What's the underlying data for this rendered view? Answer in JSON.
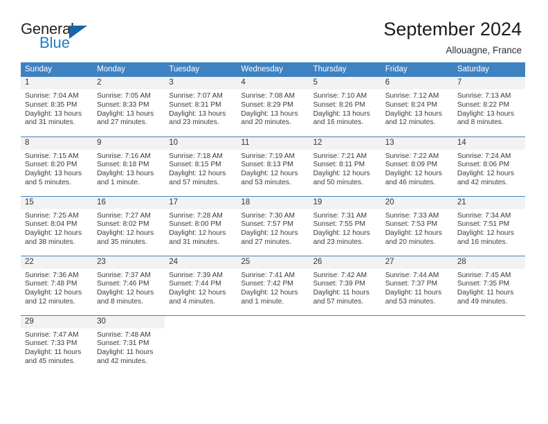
{
  "brand": {
    "name_part1": "General",
    "name_part2": "Blue",
    "triangle_icon": "triangle-icon",
    "colors": {
      "dark": "#231f20",
      "blue": "#1f7dc4",
      "triangle": "#1565a8"
    }
  },
  "header": {
    "title": "September 2024",
    "subtitle": "Allouagne, France"
  },
  "calendar": {
    "accent_color": "#3f82c2",
    "daynum_background": "#f2f2f2",
    "weekdays": [
      "Sunday",
      "Monday",
      "Tuesday",
      "Wednesday",
      "Thursday",
      "Friday",
      "Saturday"
    ],
    "weeks": [
      [
        {
          "day": "1",
          "sunrise": "Sunrise: 7:04 AM",
          "sunset": "Sunset: 8:35 PM",
          "daylight_line1": "Daylight: 13 hours",
          "daylight_line2": "and 31 minutes."
        },
        {
          "day": "2",
          "sunrise": "Sunrise: 7:05 AM",
          "sunset": "Sunset: 8:33 PM",
          "daylight_line1": "Daylight: 13 hours",
          "daylight_line2": "and 27 minutes."
        },
        {
          "day": "3",
          "sunrise": "Sunrise: 7:07 AM",
          "sunset": "Sunset: 8:31 PM",
          "daylight_line1": "Daylight: 13 hours",
          "daylight_line2": "and 23 minutes."
        },
        {
          "day": "4",
          "sunrise": "Sunrise: 7:08 AM",
          "sunset": "Sunset: 8:29 PM",
          "daylight_line1": "Daylight: 13 hours",
          "daylight_line2": "and 20 minutes."
        },
        {
          "day": "5",
          "sunrise": "Sunrise: 7:10 AM",
          "sunset": "Sunset: 8:26 PM",
          "daylight_line1": "Daylight: 13 hours",
          "daylight_line2": "and 16 minutes."
        },
        {
          "day": "6",
          "sunrise": "Sunrise: 7:12 AM",
          "sunset": "Sunset: 8:24 PM",
          "daylight_line1": "Daylight: 13 hours",
          "daylight_line2": "and 12 minutes."
        },
        {
          "day": "7",
          "sunrise": "Sunrise: 7:13 AM",
          "sunset": "Sunset: 8:22 PM",
          "daylight_line1": "Daylight: 13 hours",
          "daylight_line2": "and 8 minutes."
        }
      ],
      [
        {
          "day": "8",
          "sunrise": "Sunrise: 7:15 AM",
          "sunset": "Sunset: 8:20 PM",
          "daylight_line1": "Daylight: 13 hours",
          "daylight_line2": "and 5 minutes."
        },
        {
          "day": "9",
          "sunrise": "Sunrise: 7:16 AM",
          "sunset": "Sunset: 8:18 PM",
          "daylight_line1": "Daylight: 13 hours",
          "daylight_line2": "and 1 minute."
        },
        {
          "day": "10",
          "sunrise": "Sunrise: 7:18 AM",
          "sunset": "Sunset: 8:15 PM",
          "daylight_line1": "Daylight: 12 hours",
          "daylight_line2": "and 57 minutes."
        },
        {
          "day": "11",
          "sunrise": "Sunrise: 7:19 AM",
          "sunset": "Sunset: 8:13 PM",
          "daylight_line1": "Daylight: 12 hours",
          "daylight_line2": "and 53 minutes."
        },
        {
          "day": "12",
          "sunrise": "Sunrise: 7:21 AM",
          "sunset": "Sunset: 8:11 PM",
          "daylight_line1": "Daylight: 12 hours",
          "daylight_line2": "and 50 minutes."
        },
        {
          "day": "13",
          "sunrise": "Sunrise: 7:22 AM",
          "sunset": "Sunset: 8:09 PM",
          "daylight_line1": "Daylight: 12 hours",
          "daylight_line2": "and 46 minutes."
        },
        {
          "day": "14",
          "sunrise": "Sunrise: 7:24 AM",
          "sunset": "Sunset: 8:06 PM",
          "daylight_line1": "Daylight: 12 hours",
          "daylight_line2": "and 42 minutes."
        }
      ],
      [
        {
          "day": "15",
          "sunrise": "Sunrise: 7:25 AM",
          "sunset": "Sunset: 8:04 PM",
          "daylight_line1": "Daylight: 12 hours",
          "daylight_line2": "and 38 minutes."
        },
        {
          "day": "16",
          "sunrise": "Sunrise: 7:27 AM",
          "sunset": "Sunset: 8:02 PM",
          "daylight_line1": "Daylight: 12 hours",
          "daylight_line2": "and 35 minutes."
        },
        {
          "day": "17",
          "sunrise": "Sunrise: 7:28 AM",
          "sunset": "Sunset: 8:00 PM",
          "daylight_line1": "Daylight: 12 hours",
          "daylight_line2": "and 31 minutes."
        },
        {
          "day": "18",
          "sunrise": "Sunrise: 7:30 AM",
          "sunset": "Sunset: 7:57 PM",
          "daylight_line1": "Daylight: 12 hours",
          "daylight_line2": "and 27 minutes."
        },
        {
          "day": "19",
          "sunrise": "Sunrise: 7:31 AM",
          "sunset": "Sunset: 7:55 PM",
          "daylight_line1": "Daylight: 12 hours",
          "daylight_line2": "and 23 minutes."
        },
        {
          "day": "20",
          "sunrise": "Sunrise: 7:33 AM",
          "sunset": "Sunset: 7:53 PM",
          "daylight_line1": "Daylight: 12 hours",
          "daylight_line2": "and 20 minutes."
        },
        {
          "day": "21",
          "sunrise": "Sunrise: 7:34 AM",
          "sunset": "Sunset: 7:51 PM",
          "daylight_line1": "Daylight: 12 hours",
          "daylight_line2": "and 16 minutes."
        }
      ],
      [
        {
          "day": "22",
          "sunrise": "Sunrise: 7:36 AM",
          "sunset": "Sunset: 7:48 PM",
          "daylight_line1": "Daylight: 12 hours",
          "daylight_line2": "and 12 minutes."
        },
        {
          "day": "23",
          "sunrise": "Sunrise: 7:37 AM",
          "sunset": "Sunset: 7:46 PM",
          "daylight_line1": "Daylight: 12 hours",
          "daylight_line2": "and 8 minutes."
        },
        {
          "day": "24",
          "sunrise": "Sunrise: 7:39 AM",
          "sunset": "Sunset: 7:44 PM",
          "daylight_line1": "Daylight: 12 hours",
          "daylight_line2": "and 4 minutes."
        },
        {
          "day": "25",
          "sunrise": "Sunrise: 7:41 AM",
          "sunset": "Sunset: 7:42 PM",
          "daylight_line1": "Daylight: 12 hours",
          "daylight_line2": "and 1 minute."
        },
        {
          "day": "26",
          "sunrise": "Sunrise: 7:42 AM",
          "sunset": "Sunset: 7:39 PM",
          "daylight_line1": "Daylight: 11 hours",
          "daylight_line2": "and 57 minutes."
        },
        {
          "day": "27",
          "sunrise": "Sunrise: 7:44 AM",
          "sunset": "Sunset: 7:37 PM",
          "daylight_line1": "Daylight: 11 hours",
          "daylight_line2": "and 53 minutes."
        },
        {
          "day": "28",
          "sunrise": "Sunrise: 7:45 AM",
          "sunset": "Sunset: 7:35 PM",
          "daylight_line1": "Daylight: 11 hours",
          "daylight_line2": "and 49 minutes."
        }
      ],
      [
        {
          "day": "29",
          "sunrise": "Sunrise: 7:47 AM",
          "sunset": "Sunset: 7:33 PM",
          "daylight_line1": "Daylight: 11 hours",
          "daylight_line2": "and 45 minutes."
        },
        {
          "day": "30",
          "sunrise": "Sunrise: 7:48 AM",
          "sunset": "Sunset: 7:31 PM",
          "daylight_line1": "Daylight: 11 hours",
          "daylight_line2": "and 42 minutes."
        },
        {
          "day": "",
          "sunrise": "",
          "sunset": "",
          "daylight_line1": "",
          "daylight_line2": ""
        },
        {
          "day": "",
          "sunrise": "",
          "sunset": "",
          "daylight_line1": "",
          "daylight_line2": ""
        },
        {
          "day": "",
          "sunrise": "",
          "sunset": "",
          "daylight_line1": "",
          "daylight_line2": ""
        },
        {
          "day": "",
          "sunrise": "",
          "sunset": "",
          "daylight_line1": "",
          "daylight_line2": ""
        },
        {
          "day": "",
          "sunrise": "",
          "sunset": "",
          "daylight_line1": "",
          "daylight_line2": ""
        }
      ]
    ]
  }
}
